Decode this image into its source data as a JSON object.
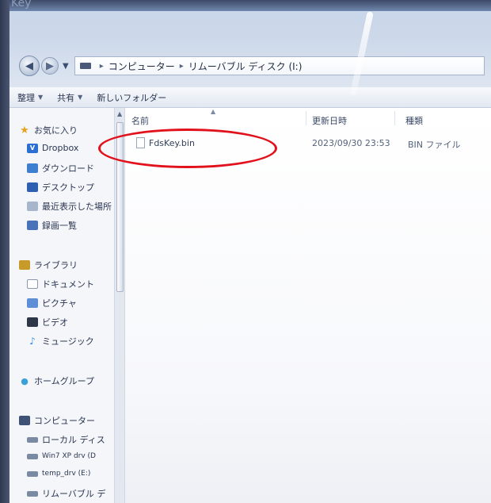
{
  "ghost_title": "Key",
  "address_bar": {
    "crumbs": [
      "コンピューター",
      "リムーバブル ディスク (I:)"
    ]
  },
  "command_bar": {
    "organize": "整理",
    "share": "共有",
    "new_folder": "新しいフォルダー"
  },
  "nav_pane": {
    "favorites": {
      "header": "お気に入り",
      "items": [
        {
          "label": "Dropbox",
          "icon": "dropbox-icon"
        },
        {
          "label": "ダウンロード",
          "icon": "download-folder-icon"
        },
        {
          "label": "デスクトップ",
          "icon": "desktop-icon"
        },
        {
          "label": "最近表示した場所",
          "icon": "recent-places-icon"
        },
        {
          "label": "録画一覧",
          "icon": "recordings-icon"
        }
      ]
    },
    "libraries": {
      "header": "ライブラリ",
      "items": [
        {
          "label": "ドキュメント",
          "icon": "documents-icon"
        },
        {
          "label": "ピクチャ",
          "icon": "pictures-icon"
        },
        {
          "label": "ビデオ",
          "icon": "videos-icon"
        },
        {
          "label": "ミュージック",
          "icon": "music-icon"
        }
      ]
    },
    "homegroup": "ホームグループ",
    "computer": {
      "header": "コンピューター",
      "items": [
        {
          "label": "ローカル ディス",
          "icon": "local-disk-icon"
        },
        {
          "label": "Win7 XP drv (D",
          "icon": "drive-icon"
        },
        {
          "label": "temp_drv (E:)",
          "icon": "drive-icon"
        },
        {
          "label": "リムーバブル デ",
          "icon": "removable-drive-icon"
        }
      ]
    }
  },
  "columns": {
    "name": "名前",
    "modified": "更新日時",
    "type": "種類"
  },
  "files": [
    {
      "name": "FdsKey.bin",
      "modified": "2023/09/30 23:53",
      "type": "BIN ファイル"
    }
  ],
  "colors": {
    "annotation": "#e2121c",
    "window_bg": "#eef1f6"
  }
}
